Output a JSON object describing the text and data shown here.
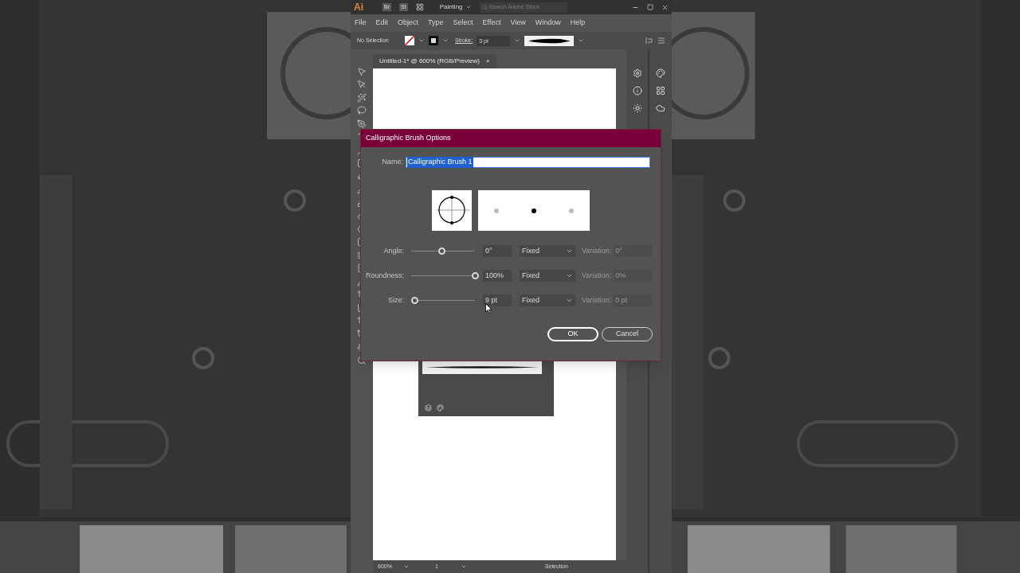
{
  "app": {
    "logo": "Ai",
    "bridge": "Br",
    "stock": "St",
    "workspace": "Painting",
    "search_placeholder": "Search Adobe Stock"
  },
  "menu": [
    "File",
    "Edit",
    "Object",
    "Type",
    "Select",
    "Effect",
    "View",
    "Window",
    "Help"
  ],
  "control_bar": {
    "selection": "No Selection",
    "stroke_label": "Stroke:",
    "stroke_weight": "3 pt"
  },
  "document_tab": {
    "title": "Untitled-1* @ 600% (RGB/Preview)",
    "close": "×"
  },
  "dialog": {
    "title": "Calligraphic Brush Options",
    "name_label": "Name:",
    "name_value": "Calligraphic Brush 1",
    "name_selected": true,
    "rows": [
      {
        "label": "Angle:",
        "level": 0.48,
        "value": "0°",
        "mode": "Fixed",
        "variation_label": "Variation:",
        "variation_value": "0°",
        "disabled": true
      },
      {
        "label": "Roundness:",
        "level": 1,
        "value": "100%",
        "mode": "Fixed",
        "variation_label": "Variation:",
        "variation_value": "0%",
        "disabled": true
      },
      {
        "label": "Size:",
        "level": 0.05,
        "value": "9 pt",
        "mode": "Fixed",
        "variation_label": "Variation:",
        "variation_value": "0 pt",
        "disabled": true
      }
    ],
    "buttons": [
      {
        "label": "OK",
        "kind": "primary"
      },
      {
        "label": "Cancel",
        "kind": "secondary"
      }
    ]
  },
  "status_bar": {
    "zoom": "600%",
    "artboard": "1",
    "tool": "Selection"
  }
}
